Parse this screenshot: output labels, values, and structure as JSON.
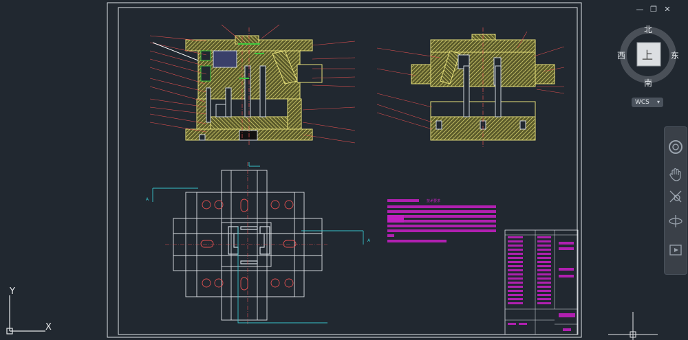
{
  "viewcube": {
    "north": "北",
    "south": "南",
    "east": "东",
    "west": "西",
    "top_face": "上",
    "wcs_label": "WCS"
  },
  "ucs": {
    "x_label": "X",
    "y_label": "Y"
  },
  "drawing": {
    "section_label_a": "A",
    "tech_req_title": "技术要求"
  },
  "window_controls": {
    "minimize": "—",
    "restore": "❐",
    "close": "✕"
  },
  "colors": {
    "background": "#212830",
    "frame": "#ffffff",
    "hatch": "#e6e07a",
    "red_leader": "#e05050",
    "cyan": "#38c4cc",
    "magenta": "#c020c0",
    "green": "#3ec83e"
  },
  "navbar_icons": [
    "steering-wheel-icon",
    "pan-hand-icon",
    "zoom-icon",
    "orbit-icon",
    "showmotion-icon"
  ]
}
